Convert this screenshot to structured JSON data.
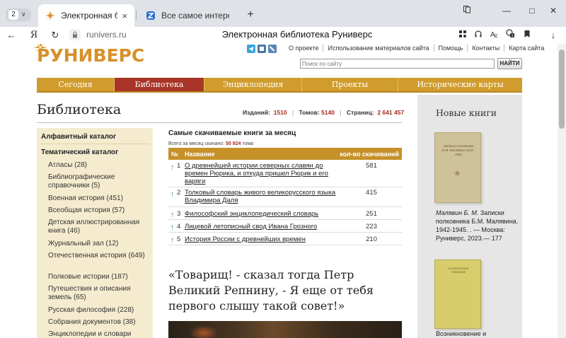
{
  "browser": {
    "tab_count": "2",
    "tabs": [
      {
        "title": "Электронная библиотека"
      },
      {
        "title": "Все самое интересное из"
      }
    ],
    "new_tab": "+",
    "address_domain": "runivers.ru",
    "page_title": "Электронная библиотека Руниверс",
    "window_controls": [
      "bookmark-icon",
      "minimize-icon",
      "maximize-icon",
      "close-icon"
    ]
  },
  "site": {
    "logo": "РУНИВЕРС",
    "top_links": [
      "О проекте",
      "Использование материалов сайта",
      "Помощь",
      "Контакты",
      "Карта сайта"
    ],
    "search": {
      "placeholder": "Поиск по сайту",
      "button": "НАЙТИ"
    },
    "nav": [
      {
        "label": "Сегодня"
      },
      {
        "label": "Библиотека",
        "active": true
      },
      {
        "label": "Энциклопедия"
      },
      {
        "label": "Проекты"
      },
      {
        "label": "Исторические карты"
      }
    ],
    "colors": {
      "gold": "#d09c2d",
      "active_red": "#a83527",
      "value_red": "#a52a1d"
    }
  },
  "page": {
    "heading": "Библиотека",
    "stats": {
      "editions_label": "Изданий:",
      "editions": "1510",
      "volumes_label": "Томов:",
      "volumes": "5140",
      "pages_label": "Страниц:",
      "pages": "2 641 457"
    }
  },
  "left_menu": {
    "alpha": "Алфавитный каталог",
    "thematic": "Тематический каталог",
    "items": [
      "Атласы (28)",
      "Библиографические справочники (5)",
      "Военная история (451)",
      "Всеобщая история (57)",
      "Детская иллюстрированная книга (46)",
      "Журнальный зал (12)",
      "Отечественная история (649)",
      "Полковые истории (187)",
      "Путешествия и описания земель (65)",
      "Русская философия (228)",
      "Собрания документов (38)",
      "Энциклопедии и словари"
    ]
  },
  "top_books": {
    "title": "Самые скачиваемые книги за месяц",
    "subtitle_prefix": "Всего за месяц скачано:",
    "subtitle_value": "50 924",
    "subtitle_suffix": "тома",
    "columns": {
      "num": "№",
      "name": "Название",
      "count": "кол-во скачиваний"
    },
    "rows": [
      {
        "rank": "1",
        "name": "О древнейшей истории северных славян до времен Рюрика, и откуда пришел Рюрик и его варяги",
        "count": "581"
      },
      {
        "rank": "2",
        "name": "Толковый словарь живого великорусского языка Владимира Даля",
        "count": "415"
      },
      {
        "rank": "3",
        "name": "Философский энциклопедический словарь",
        "count": "251"
      },
      {
        "rank": "4",
        "name": "Лицевой летописный свод Ивана Грозного",
        "count": "223"
      },
      {
        "rank": "5",
        "name": "История России с древнейших времен",
        "count": "210"
      }
    ]
  },
  "quote": "«Товарищ! - сказал тогда Петр Великий Репнину, - Я еще от тебя первого слышу такой совет!»",
  "new_books": {
    "title": "Новые книги",
    "book1_cover": "Записки полковника Б.М. Малявина 1942–1945",
    "book1_author": "Малявин Б. М.",
    "book1_desc": "Записки полковника Б.М. Малявина. 1942-1945. . — Москва: Руниверс, 2023.— 177",
    "book2_cover": "ИСТОРИЧЕСКОЕ ОПИСАНИЕ",
    "book2_desc": "Возникновение и"
  }
}
